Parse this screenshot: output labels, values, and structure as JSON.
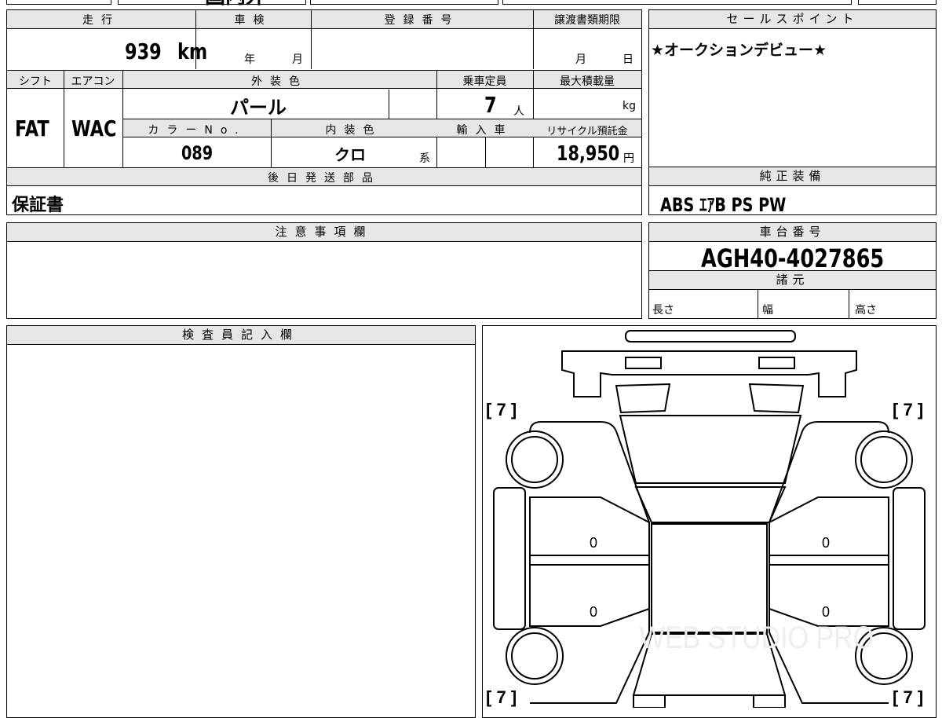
{
  "top_strip": {
    "partial_text": "国内外"
  },
  "vehicle_info": {
    "mileage_header": "走行",
    "mileage_value": "939",
    "mileage_unit": "km",
    "inspection_header": "車検",
    "inspection_year_label": "年",
    "inspection_month_label": "月",
    "registration_header": "登録番号",
    "transfer_deadline_header": "譲渡書類期限",
    "transfer_month_label": "月",
    "transfer_day_label": "日",
    "shift_header": "シフト",
    "shift_value": "FAT",
    "aircon_header": "エアコン",
    "aircon_value": "WAC",
    "exterior_color_header": "外装色",
    "exterior_color_value": "パール",
    "capacity_header": "乗車定員",
    "capacity_value": "7",
    "capacity_unit": "人",
    "max_load_header": "最大積載量",
    "max_load_unit": "kg",
    "color_no_header": "カラーNo.",
    "color_no_value": "089",
    "interior_color_header": "内装色",
    "interior_color_value": "クロ",
    "interior_color_suffix": "系",
    "import_header": "輸入車",
    "recycle_header": "リサイクル預託金",
    "recycle_value": "18,950",
    "recycle_unit": "円"
  },
  "later_shipped": {
    "header": "後日発送部品",
    "value": "保証書"
  },
  "sales_point": {
    "header": "セールスポイント",
    "value": "★オークションデビュー★"
  },
  "standard_equipment": {
    "header": "純正装備",
    "value": "ABS ｴｱB PS PW"
  },
  "notes": {
    "header": "注意事項欄",
    "value": ""
  },
  "chassis": {
    "header": "車台番号",
    "value": "AGH40-4027865"
  },
  "specs": {
    "header": "諸元",
    "length_label": "長さ",
    "width_label": "幅",
    "height_label": "高さ"
  },
  "inspector": {
    "header": "検査員記入欄",
    "value": ""
  },
  "diagram": {
    "tire_marks": [
      "7",
      "7",
      "7",
      "7"
    ],
    "door_marks": [
      "0",
      "0",
      "0",
      "0"
    ],
    "watermark": "WEB STUDIO PRO"
  }
}
